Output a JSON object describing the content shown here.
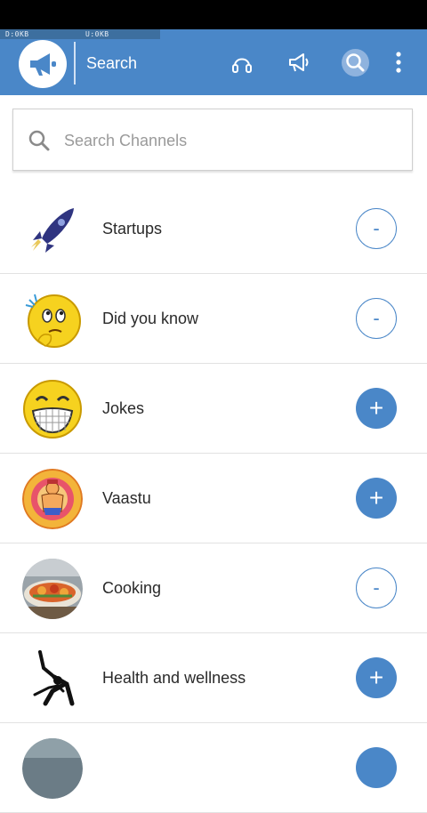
{
  "status_bar": {
    "download": "D:0KB",
    "upload": "U:0KB"
  },
  "app_bar": {
    "title": "Search",
    "logo_icon": "megaphone-icon",
    "actions": [
      "headphones-icon",
      "megaphone-icon",
      "search-icon",
      "overflow-menu-icon"
    ],
    "accent_color": "#4a87c8"
  },
  "search": {
    "placeholder": "Search Channels",
    "value": ""
  },
  "channels": [
    {
      "name": "Startups",
      "icon": "rocket-icon",
      "subscribed": true,
      "button_label": "-"
    },
    {
      "name": "Did you know",
      "icon": "thinking-smiley-icon",
      "subscribed": true,
      "button_label": "-"
    },
    {
      "name": "Jokes",
      "icon": "laughing-smiley-icon",
      "subscribed": false,
      "button_label": "+"
    },
    {
      "name": "Vaastu",
      "icon": "vaastu-deity-icon",
      "subscribed": false,
      "button_label": "+"
    },
    {
      "name": "Cooking",
      "icon": "cooking-dish-icon",
      "subscribed": true,
      "button_label": "-"
    },
    {
      "name": "Health and wellness",
      "icon": "yoga-pose-icon",
      "subscribed": false,
      "button_label": "+"
    },
    {
      "name": "",
      "icon": "channel-thumbnail-icon",
      "subscribed": false,
      "button_label": ""
    }
  ]
}
